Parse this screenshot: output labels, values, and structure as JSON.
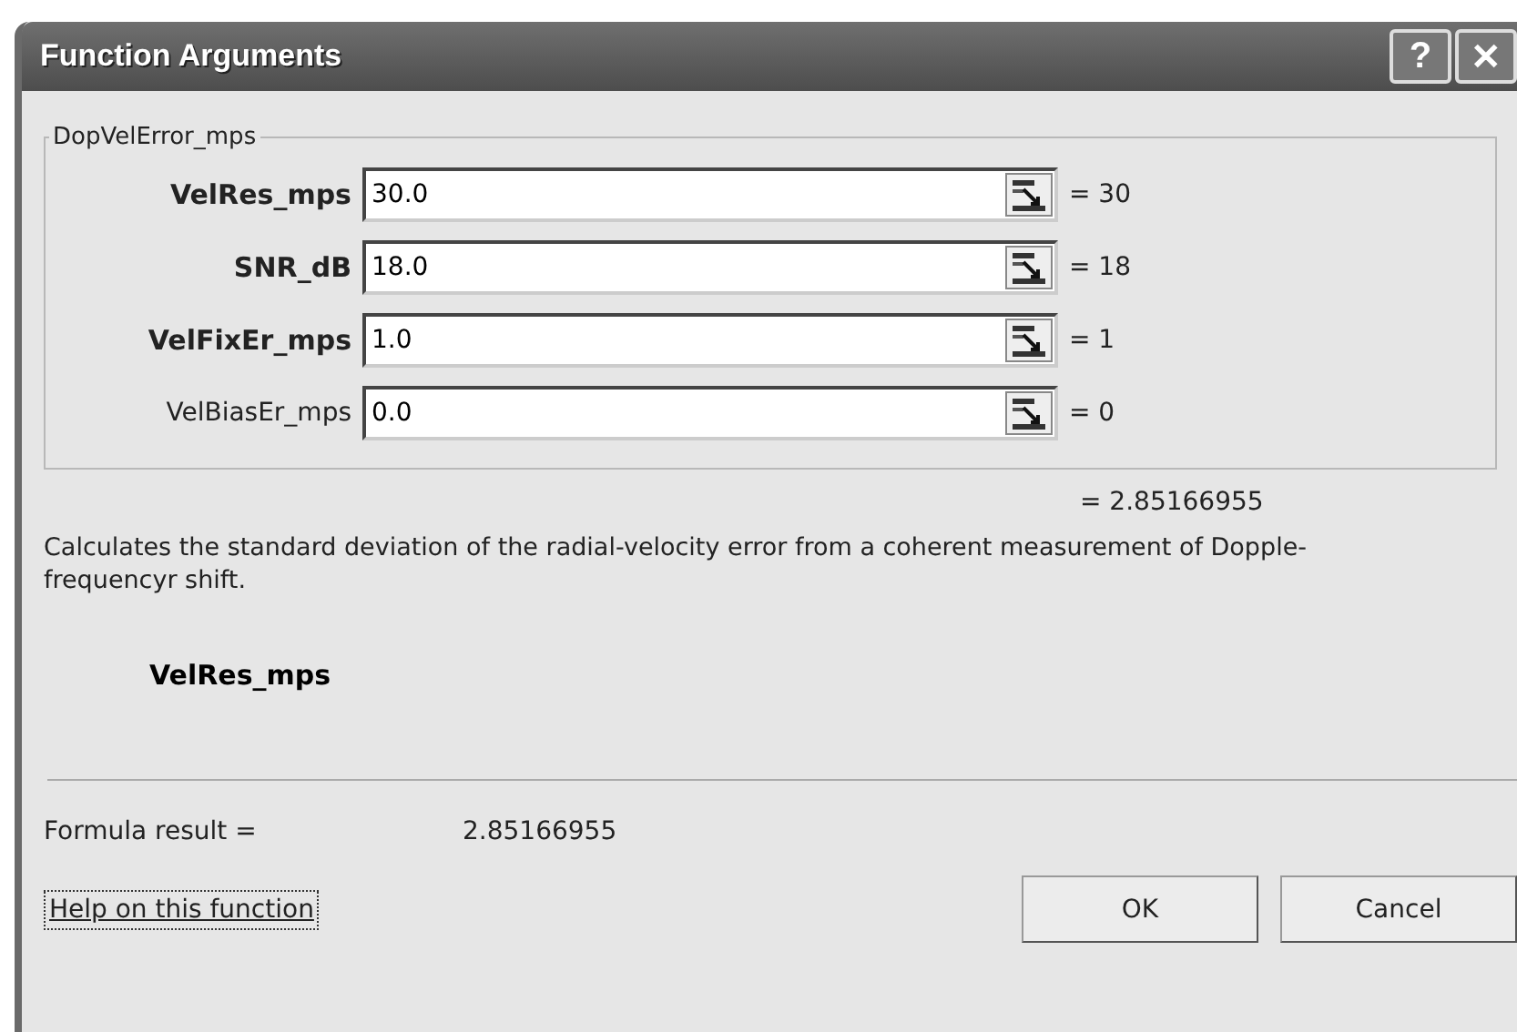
{
  "window": {
    "title": "Function Arguments",
    "help_button": "?",
    "close_button": "✕"
  },
  "group": {
    "title": "DopVelError_mps",
    "arguments": [
      {
        "name": "VelRes_mps",
        "required": true,
        "value": "30.0",
        "result": "= 30"
      },
      {
        "name": "SNR_dB",
        "required": true,
        "value": "18.0",
        "result": "= 18"
      },
      {
        "name": "VelFixEr_mps",
        "required": true,
        "value": "1.0",
        "result": "= 1"
      },
      {
        "name": "VelBiasEr_mps",
        "required": false,
        "value": "0.0",
        "result": "= 0"
      }
    ]
  },
  "function_result": "= 2.85166955",
  "description": "Calculates the standard deviation of the radial-velocity error from a coherent measurement of Dopple-frequencyr shift.",
  "argument_help": {
    "name": "VelRes_mps"
  },
  "formula_result": {
    "label": "Formula result =",
    "value": "2.85166955"
  },
  "help_link": "Help on this function",
  "buttons": [
    "OK",
    "Cancel"
  ]
}
